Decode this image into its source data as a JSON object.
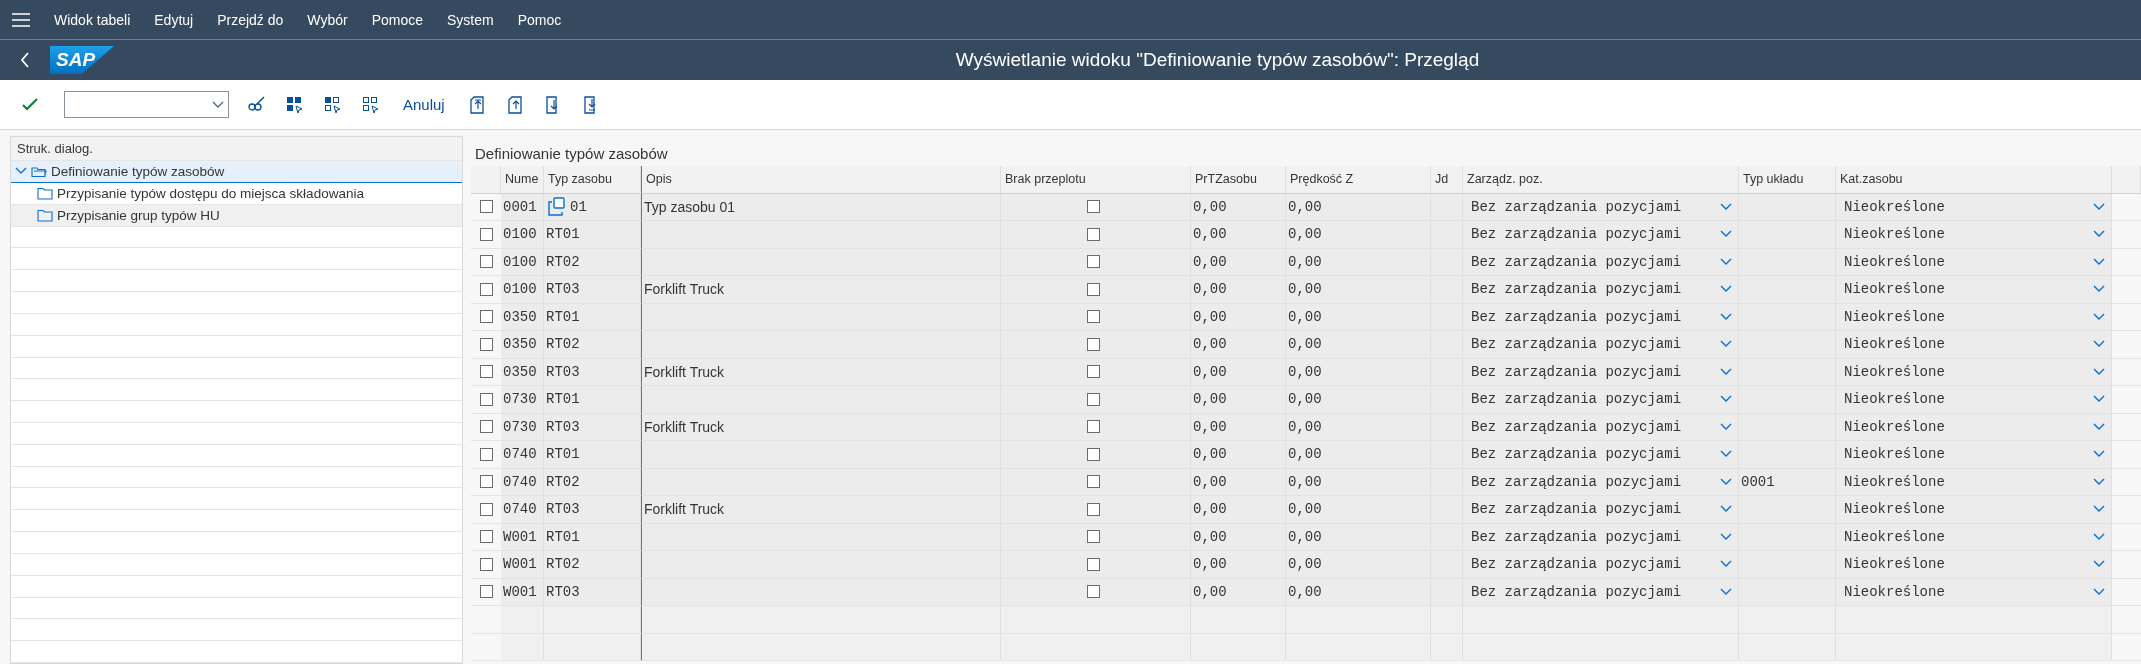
{
  "menu": [
    {
      "label": "Widok tabeli"
    },
    {
      "label": "Edytuj"
    },
    {
      "label": "Przejdź do"
    },
    {
      "label": "Wybór"
    },
    {
      "label": "Pomoce"
    },
    {
      "label": "System"
    },
    {
      "label": "Pomoc"
    }
  ],
  "header": {
    "logo": "SAP",
    "title": "Wyświetlanie widoku \"Definiowanie typów zasobów\": Przegląd"
  },
  "toolbar": {
    "cancel_button": "Anuluj"
  },
  "tree": {
    "header": "Struk. dialog.",
    "items": [
      {
        "label": "Definiowanie typów zasobów",
        "selected": true,
        "expanded": true,
        "children": [
          {
            "label": "Przypisanie typów dostępu do miejsca składowania",
            "selected": false,
            "highlighted": false
          },
          {
            "label": "Przypisanie grup typów HU",
            "selected": false,
            "highlighted": true
          }
        ]
      }
    ]
  },
  "table": {
    "title": "Definiowanie typów zasobów",
    "columns": [
      "Nume",
      "Typ zasobu",
      "Opis",
      "Brak przeplotu",
      "PrTZasobu",
      "Prędkość Z",
      "Jd",
      "Zarządz. poz.",
      "Typ układu",
      "Kat.zasobu"
    ],
    "rows": [
      {
        "selected": false,
        "nume": "0001",
        "typ": "01",
        "typ_covered": true,
        "opis": "Typ zasobu 01",
        "brak_checked": false,
        "prt": "0,00",
        "predkosc": "0,00",
        "zarzadz": "Bez zarządzania pozycjami",
        "typ_ukladu": "",
        "kat": "Nieokreślone"
      },
      {
        "selected": false,
        "nume": "0100",
        "typ": "RT01",
        "typ_covered": false,
        "opis": "",
        "brak_checked": false,
        "prt": "0,00",
        "predkosc": "0,00",
        "zarzadz": "Bez zarządzania pozycjami",
        "typ_ukladu": "",
        "kat": "Nieokreślone"
      },
      {
        "selected": false,
        "nume": "0100",
        "typ": "RT02",
        "typ_covered": false,
        "opis": "",
        "brak_checked": false,
        "prt": "0,00",
        "predkosc": "0,00",
        "zarzadz": "Bez zarządzania pozycjami",
        "typ_ukladu": "",
        "kat": "Nieokreślone"
      },
      {
        "selected": false,
        "nume": "0100",
        "typ": "RT03",
        "typ_covered": false,
        "opis": "Forklift Truck",
        "brak_checked": false,
        "prt": "0,00",
        "predkosc": "0,00",
        "zarzadz": "Bez zarządzania pozycjami",
        "typ_ukladu": "",
        "kat": "Nieokreślone"
      },
      {
        "selected": false,
        "nume": "0350",
        "typ": "RT01",
        "typ_covered": false,
        "opis": "",
        "brak_checked": false,
        "prt": "0,00",
        "predkosc": "0,00",
        "zarzadz": "Bez zarządzania pozycjami",
        "typ_ukladu": "",
        "kat": "Nieokreślone"
      },
      {
        "selected": false,
        "nume": "0350",
        "typ": "RT02",
        "typ_covered": false,
        "opis": "",
        "brak_checked": false,
        "prt": "0,00",
        "predkosc": "0,00",
        "zarzadz": "Bez zarządzania pozycjami",
        "typ_ukladu": "",
        "kat": "Nieokreślone"
      },
      {
        "selected": false,
        "nume": "0350",
        "typ": "RT03",
        "typ_covered": false,
        "opis": "Forklift Truck",
        "brak_checked": false,
        "prt": "0,00",
        "predkosc": "0,00",
        "zarzadz": "Bez zarządzania pozycjami",
        "typ_ukladu": "",
        "kat": "Nieokreślone"
      },
      {
        "selected": false,
        "nume": "0730",
        "typ": "RT01",
        "typ_covered": false,
        "opis": "",
        "brak_checked": false,
        "prt": "0,00",
        "predkosc": "0,00",
        "zarzadz": "Bez zarządzania pozycjami",
        "typ_ukladu": "",
        "kat": "Nieokreślone"
      },
      {
        "selected": false,
        "nume": "0730",
        "typ": "RT03",
        "typ_covered": false,
        "opis": "Forklift Truck",
        "brak_checked": false,
        "prt": "0,00",
        "predkosc": "0,00",
        "zarzadz": "Bez zarządzania pozycjami",
        "typ_ukladu": "",
        "kat": "Nieokreślone"
      },
      {
        "selected": false,
        "nume": "0740",
        "typ": "RT01",
        "typ_covered": false,
        "opis": "",
        "brak_checked": false,
        "prt": "0,00",
        "predkosc": "0,00",
        "zarzadz": "Bez zarządzania pozycjami",
        "typ_ukladu": "",
        "kat": "Nieokreślone"
      },
      {
        "selected": false,
        "nume": "0740",
        "typ": "RT02",
        "typ_covered": false,
        "opis": "",
        "brak_checked": false,
        "prt": "0,00",
        "predkosc": "0,00",
        "zarzadz": "Bez zarządzania pozycjami",
        "typ_ukladu": "0001",
        "kat": "Nieokreślone"
      },
      {
        "selected": false,
        "nume": "0740",
        "typ": "RT03",
        "typ_covered": false,
        "opis": "Forklift Truck",
        "brak_checked": false,
        "prt": "0,00",
        "predkosc": "0,00",
        "zarzadz": "Bez zarządzania pozycjami",
        "typ_ukladu": "",
        "kat": "Nieokreślone"
      },
      {
        "selected": false,
        "nume": "W001",
        "typ": "RT01",
        "typ_covered": false,
        "opis": "",
        "brak_checked": false,
        "prt": "0,00",
        "predkosc": "0,00",
        "zarzadz": "Bez zarządzania pozycjami",
        "typ_ukladu": "",
        "kat": "Nieokreślone"
      },
      {
        "selected": false,
        "nume": "W001",
        "typ": "RT02",
        "typ_covered": false,
        "opis": "",
        "brak_checked": false,
        "prt": "0,00",
        "predkosc": "0,00",
        "zarzadz": "Bez zarządzania pozycjami",
        "typ_ukladu": "",
        "kat": "Nieokreślone"
      },
      {
        "selected": false,
        "nume": "W001",
        "typ": "RT03",
        "typ_covered": false,
        "opis": "",
        "brak_checked": false,
        "prt": "0,00",
        "predkosc": "0,00",
        "zarzadz": "Bez zarządzania pozycjami",
        "typ_ukladu": "",
        "kat": "Nieokreślone"
      }
    ]
  }
}
